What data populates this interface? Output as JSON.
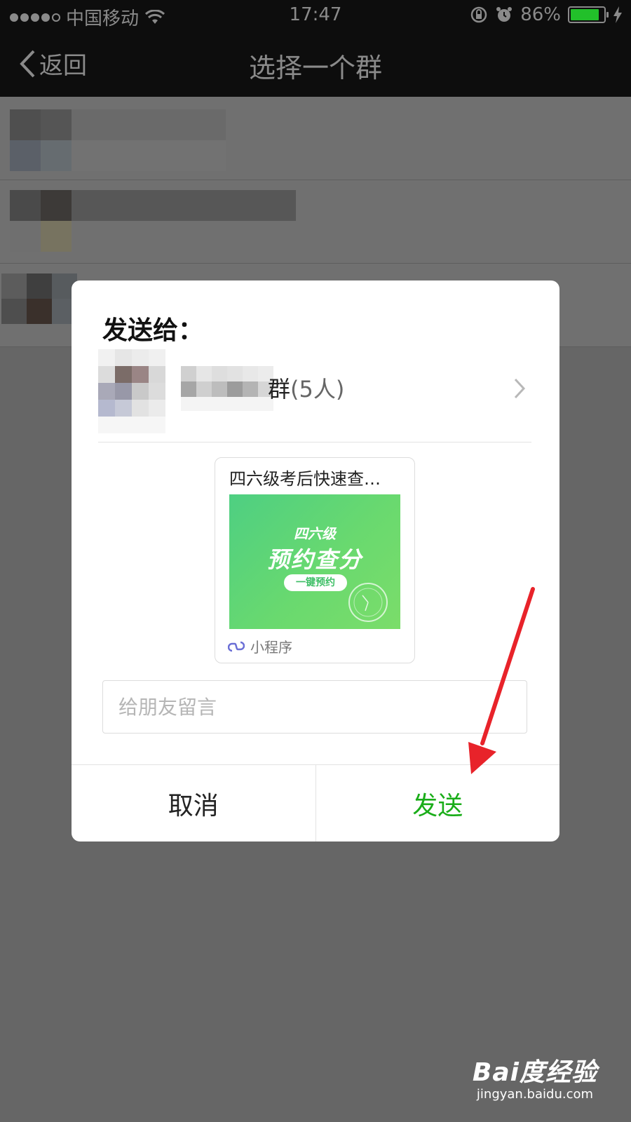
{
  "status_bar": {
    "carrier": "中国移动",
    "time": "17:47",
    "battery_percent": "86%",
    "battery_level": 0.86,
    "signal_icon": "signal-dots",
    "wifi_icon": "wifi-icon",
    "lock_icon": "rotation-lock-icon",
    "alarm_icon": "alarm-icon",
    "charging_icon": "charging-bolt-icon"
  },
  "nav": {
    "back_label": "返回",
    "title": "选择一个群"
  },
  "dialog": {
    "title": "发送给：",
    "recipient": {
      "name_visible": "群",
      "count": "(5人)"
    },
    "card": {
      "title": "四六级考后快速查…",
      "image_subtitle": "四六级",
      "image_title": "预约查分",
      "image_button": "一键预约",
      "footer_label": "小程序",
      "footer_icon": "mini-program-icon"
    },
    "message_input": {
      "placeholder": "给朋友留言",
      "value": ""
    },
    "cancel_label": "取消",
    "send_label": "发送"
  },
  "colors": {
    "accent_green": "#1aad19",
    "arrow_red": "#e8232a",
    "overlay": "#666666"
  },
  "watermark": {
    "logo": "Bai度经验",
    "url": "jingyan.baidu.com"
  }
}
